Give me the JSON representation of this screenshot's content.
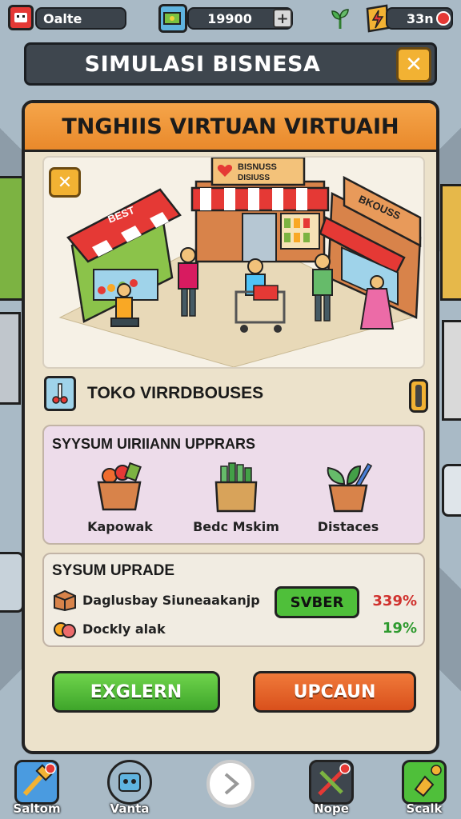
{
  "top_bar": {
    "user_label": "Oalte",
    "money": "19900",
    "money_add": "+",
    "timer": "33n"
  },
  "header": {
    "title": "SIMULASI BISNESA",
    "close_glyph": "✕"
  },
  "panel": {
    "title": "TNGHIIS VIRTUAN VIRTUAIH",
    "close_glyph": "✕",
    "scene_signs": {
      "left": "BEST",
      "center_line1": "BISNUSS",
      "center_line2": "DISIUSS",
      "right": "BKOUSS"
    },
    "shop_name": "TOKO VIRRDBOUSES"
  },
  "upgrades_section": {
    "title": "SYYSUM UIRIIANN UPPRARS",
    "items": [
      {
        "label": "Kapowak",
        "icon": "fruit-basket-icon"
      },
      {
        "label": "Bedc Mskim",
        "icon": "vegetable-box-icon"
      },
      {
        "label": "Distaces",
        "icon": "plant-pot-icon"
      }
    ]
  },
  "upgrade_section": {
    "title": "SYSUM UPRADE",
    "rows": [
      {
        "label": "Daglusbay Siuneaakanjp",
        "value": "339%",
        "value_color": "#d0312d"
      },
      {
        "label": "Dockly alak",
        "value": "19%",
        "value_color": "#2f9a2f"
      }
    ],
    "button_label": "SVBER"
  },
  "actions": {
    "primary": "EXGLERN",
    "secondary": "UPCAUN"
  },
  "bottom_nav": [
    {
      "label": "Saltom"
    },
    {
      "label": "Vanta"
    },
    {
      "label": ""
    },
    {
      "label": "Nope"
    },
    {
      "label": "Scalk"
    }
  ],
  "colors": {
    "accent_orange": "#f0962f",
    "green_button": "#4fbf3a",
    "orange_button": "#e8622a",
    "close_yellow": "#f2b233"
  }
}
